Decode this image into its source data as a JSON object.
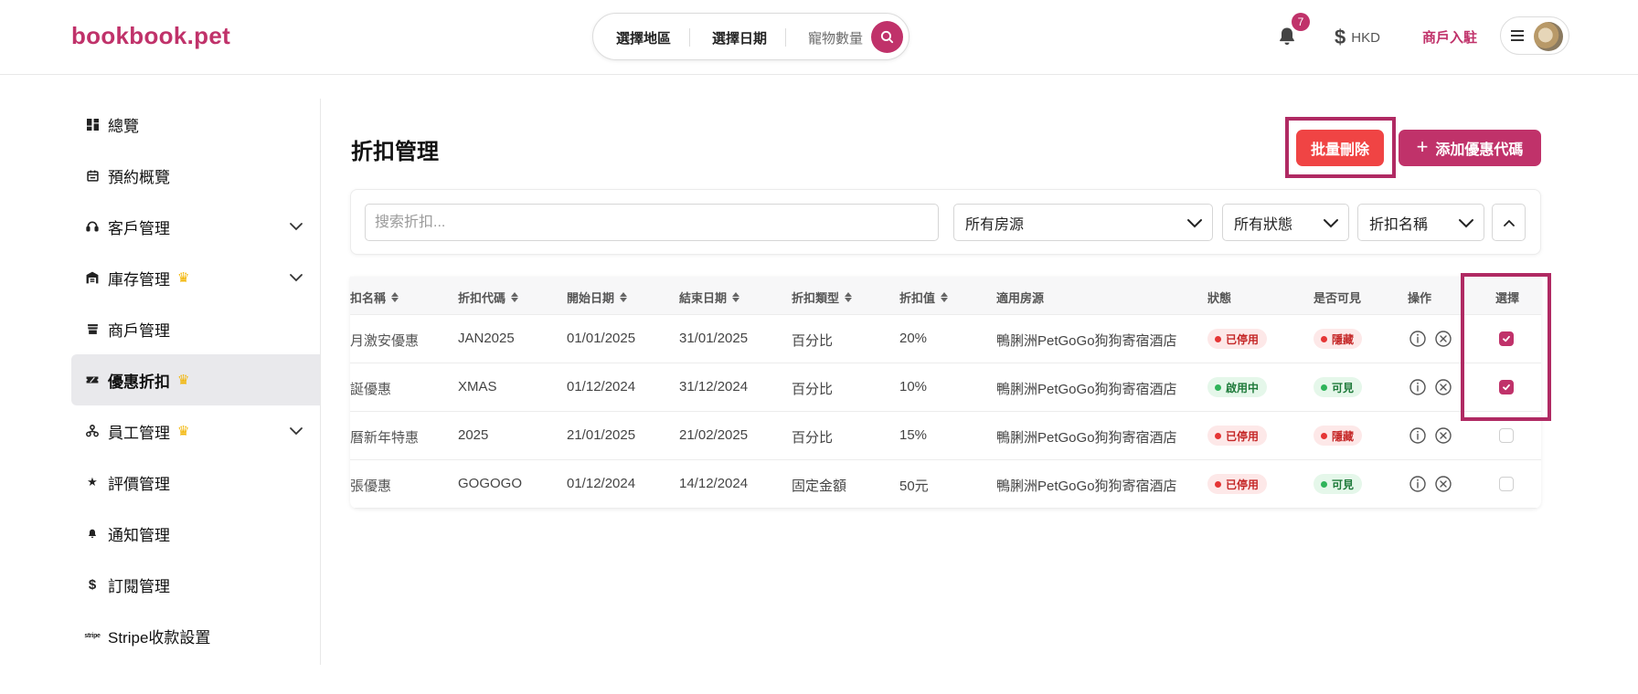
{
  "header": {
    "logo": "bookbook.pet",
    "search": {
      "region": "選擇地區",
      "date": "選擇日期",
      "pets": "寵物數量"
    },
    "notifications_count": "7",
    "currency": "HKD",
    "merchant_link": "商戶入駐"
  },
  "sidebar": {
    "items": [
      {
        "label": "總覽",
        "icon": "dashboard-icon",
        "active": false,
        "crown": false,
        "expandable": false
      },
      {
        "label": "預約概覽",
        "icon": "calendar-icon",
        "active": false,
        "crown": false,
        "expandable": false
      },
      {
        "label": "客戶管理",
        "icon": "headset-icon",
        "active": false,
        "crown": false,
        "expandable": true
      },
      {
        "label": "庫存管理",
        "icon": "warehouse-icon",
        "active": false,
        "crown": true,
        "expandable": true
      },
      {
        "label": "商戶管理",
        "icon": "store-icon",
        "active": false,
        "crown": false,
        "expandable": false
      },
      {
        "label": "優惠折扣",
        "icon": "coupon-icon",
        "active": true,
        "crown": true,
        "expandable": false
      },
      {
        "label": "員工管理",
        "icon": "team-icon",
        "active": false,
        "crown": true,
        "expandable": true
      },
      {
        "label": "評價管理",
        "icon": "star-icon",
        "active": false,
        "crown": false,
        "expandable": false
      },
      {
        "label": "通知管理",
        "icon": "bell-icon",
        "active": false,
        "crown": false,
        "expandable": false
      },
      {
        "label": "訂閱管理",
        "icon": "dollar-icon",
        "active": false,
        "crown": false,
        "expandable": false
      },
      {
        "label": "Stripe收款設置",
        "icon": "stripe-icon",
        "active": false,
        "crown": false,
        "expandable": false
      }
    ]
  },
  "main": {
    "title": "折扣管理",
    "bulk_delete_label": "批量刪除",
    "add_promo_label": "添加優惠代碼",
    "filters": {
      "search_placeholder": "搜索折扣...",
      "property": "所有房源",
      "status": "所有狀態",
      "sort_by": "折扣名稱"
    },
    "table": {
      "headers": {
        "name": "扣名稱",
        "code": "折扣代碼",
        "start": "開始日期",
        "end": "結束日期",
        "type": "折扣類型",
        "value": "折扣值",
        "property": "適用房源",
        "status": "狀態",
        "visible": "是否可見",
        "actions": "操作",
        "select": "選擇"
      },
      "rows": [
        {
          "name": "月激安優惠",
          "code": "JAN2025",
          "start": "01/01/2025",
          "end": "31/01/2025",
          "type": "百分比",
          "value": "20%",
          "property": "鴨脷洲PetGoGo狗狗寄宿酒店",
          "status": "已停用",
          "status_color": "red",
          "visibility": "隱藏",
          "visibility_color": "red",
          "selected": true
        },
        {
          "name": "誕優惠",
          "code": "XMAS",
          "start": "01/12/2024",
          "end": "31/12/2024",
          "type": "百分比",
          "value": "10%",
          "property": "鴨脷洲PetGoGo狗狗寄宿酒店",
          "status": "啟用中",
          "status_color": "green",
          "visibility": "可見",
          "visibility_color": "green",
          "selected": true
        },
        {
          "name": "曆新年特惠",
          "code": "2025",
          "start": "21/01/2025",
          "end": "21/02/2025",
          "type": "百分比",
          "value": "15%",
          "property": "鴨脷洲PetGoGo狗狗寄宿酒店",
          "status": "已停用",
          "status_color": "red",
          "visibility": "隱藏",
          "visibility_color": "red",
          "selected": false
        },
        {
          "name": "張優惠",
          "code": "GOGOGO",
          "start": "01/12/2024",
          "end": "14/12/2024",
          "type": "固定金額",
          "value": "50元",
          "property": "鴨脷洲PetGoGo狗狗寄宿酒店",
          "status": "已停用",
          "status_color": "red",
          "visibility": "可見",
          "visibility_color": "green",
          "selected": false
        }
      ]
    }
  },
  "colors": {
    "brand": "#c0326a",
    "danger": "#f04444",
    "highlight_border": "#b02a63",
    "crown": "#f2b400"
  }
}
